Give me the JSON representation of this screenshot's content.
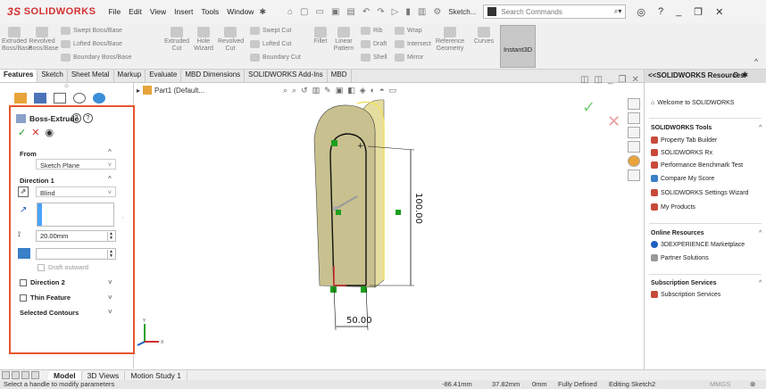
{
  "app": {
    "logo_ds": "3S",
    "logo_text": "SOLIDWORKS"
  },
  "menu": [
    "File",
    "Edit",
    "View",
    "Insert",
    "Tools",
    "Window"
  ],
  "sketch_tag": "Sketch...",
  "search": {
    "placeholder": "Search Commands"
  },
  "ribbon": {
    "extruded_boss": "Extruded Boss/Base",
    "revolved_boss": "Revolved Boss/Base",
    "swept_boss": "Swept Boss/Base",
    "lofted_boss": "Lofted Boss/Base",
    "boundary_boss": "Boundary Boss/Base",
    "extruded_cut": "Extruded Cut",
    "hole_wizard": "Hole Wizard",
    "revolved_cut": "Revolved Cut",
    "swept_cut": "Swept Cut",
    "lofted_cut": "Lofted Cut",
    "boundary_cut": "Boundary Cut",
    "fillet": "Fillet",
    "linear_pattern": "Linear Pattern",
    "rib": "Rib",
    "draft": "Draft",
    "shell": "Shell",
    "wrap": "Wrap",
    "intersect": "Intersect",
    "mirror": "Mirror",
    "reference_geometry": "Reference Geometry",
    "curves": "Curves",
    "instant3d": "Instant3D"
  },
  "tabs": [
    "Features",
    "Sketch",
    "Sheet Metal",
    "Markup",
    "Evaluate",
    "MBD Dimensions",
    "SOLIDWORKS Add-Ins",
    "MBD"
  ],
  "tree": {
    "part": "Part1 (Default..."
  },
  "property_manager": {
    "title": "Boss-Extrude",
    "from_label": "From",
    "from_value": "Sketch Plane",
    "direction1_label": "Direction 1",
    "direction1_type": "Blind",
    "depth": "20.00mm",
    "draft_outward": "Draft outward",
    "direction2": "Direction 2",
    "thin_feature": "Thin Feature",
    "selected_contours": "Selected Contours"
  },
  "dimensions": {
    "height": "100.00",
    "width": "50.00"
  },
  "taskpane": {
    "header": "<<SOLIDWORKS Resources",
    "welcome": "Welcome to SOLIDWORKS",
    "tools_title": "SOLIDWORKS Tools",
    "tools": [
      "Property Tab Builder",
      "SOLIDWORKS Rx",
      "Performance Benchmark Test",
      "Compare My Score",
      "SOLIDWORKS Settings Wizard",
      "My Products"
    ],
    "online_title": "Online Resources",
    "online": [
      "3DEXPERIENCE Marketplace",
      "Partner Solutions"
    ],
    "subscription_title": "Subscription Services",
    "subscription": [
      "Subscription Services"
    ]
  },
  "bottom_tabs": [
    "Model",
    "3D Views",
    "Motion Study 1"
  ],
  "status": {
    "message": "Select a handle to modify parameters",
    "x": "-86.41mm",
    "y": "37.82mm",
    "z": "0mm",
    "state": "Fully Defined",
    "editing": "Editing Sketch2",
    "units": "MMGS"
  },
  "colors": {
    "accent_red": "#d32f2f",
    "frame_orange": "#e8552d",
    "model_fill": "#c8c08f",
    "selection_green": "#1e9e1e"
  }
}
